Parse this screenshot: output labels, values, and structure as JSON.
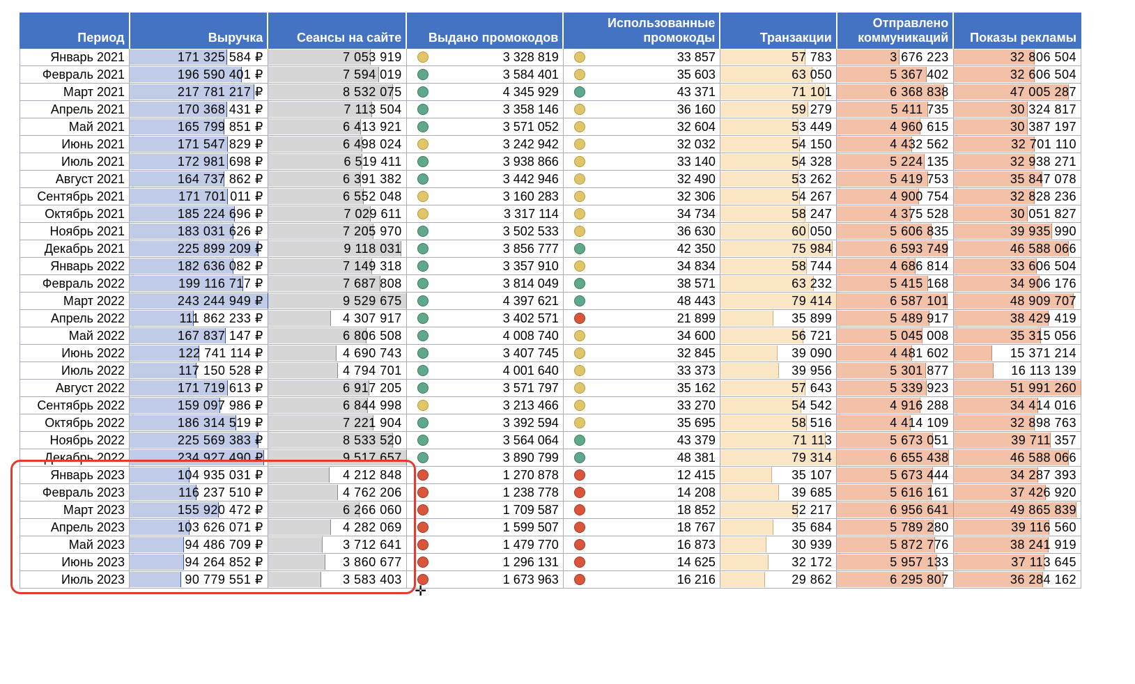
{
  "headers": {
    "period": "Период",
    "revenue": "Выручка",
    "sessions": "Сеансы на сайте",
    "promos_issued": "Выдано промокодов",
    "promos_used": "Использованные промокоды",
    "transactions": "Транзакции",
    "comms_sent": "Отправлено коммуникаций",
    "ad_impressions": "Показы рекламы"
  },
  "max": {
    "revenue": 243244949,
    "sessions": 9529675,
    "transactions": 79414,
    "comms_sent": 6956641,
    "ad_impressions": 51991260
  },
  "indicator_colors": {
    "green": "green",
    "yellow": "yellow",
    "red": "red"
  },
  "highlight": {
    "from_row": 24,
    "to_row": 30
  },
  "rows": [
    {
      "period": "Январь 2021",
      "revenue": "171 325 584 ₽",
      "revenue_n": 171325584,
      "sessions": "7 053 919",
      "sessions_n": 7053919,
      "pi_dot": "yellow",
      "pi": "3 328 819",
      "pu_dot": "yellow",
      "pu": "33 857",
      "tx": "57 783",
      "tx_n": 57783,
      "comm": "3 676 223",
      "comm_n": 3676223,
      "ads": "32 806 504",
      "ads_n": 32806504
    },
    {
      "period": "Февраль 2021",
      "revenue": "196 590 401 ₽",
      "revenue_n": 196590401,
      "sessions": "7 594 019",
      "sessions_n": 7594019,
      "pi_dot": "green",
      "pi": "3 584 401",
      "pu_dot": "yellow",
      "pu": "35 603",
      "tx": "63 050",
      "tx_n": 63050,
      "comm": "5 367 402",
      "comm_n": 5367402,
      "ads": "32 606 504",
      "ads_n": 32606504
    },
    {
      "period": "Март 2021",
      "revenue": "217 781 217 ₽",
      "revenue_n": 217781217,
      "sessions": "8 532 075",
      "sessions_n": 8532075,
      "pi_dot": "green",
      "pi": "4 345 929",
      "pu_dot": "green",
      "pu": "43 371",
      "tx": "71 101",
      "tx_n": 71101,
      "comm": "6 368 838",
      "comm_n": 6368838,
      "ads": "47 005 287",
      "ads_n": 47005287
    },
    {
      "period": "Апрель 2021",
      "revenue": "170 368 431 ₽",
      "revenue_n": 170368431,
      "sessions": "7 113 504",
      "sessions_n": 7113504,
      "pi_dot": "green",
      "pi": "3 358 146",
      "pu_dot": "yellow",
      "pu": "36 160",
      "tx": "59 279",
      "tx_n": 59279,
      "comm": "5 411 735",
      "comm_n": 5411735,
      "ads": "30 324 817",
      "ads_n": 30324817
    },
    {
      "period": "Май 2021",
      "revenue": "165 799 851 ₽",
      "revenue_n": 165799851,
      "sessions": "6 413 921",
      "sessions_n": 6413921,
      "pi_dot": "green",
      "pi": "3 571 052",
      "pu_dot": "yellow",
      "pu": "32 604",
      "tx": "53 449",
      "tx_n": 53449,
      "comm": "4 960 615",
      "comm_n": 4960615,
      "ads": "30 387 197",
      "ads_n": 30387197
    },
    {
      "period": "Июнь 2021",
      "revenue": "171 547 829 ₽",
      "revenue_n": 171547829,
      "sessions": "6 498 024",
      "sessions_n": 6498024,
      "pi_dot": "yellow",
      "pi": "3 242 942",
      "pu_dot": "yellow",
      "pu": "32 032",
      "tx": "54 150",
      "tx_n": 54150,
      "comm": "4 432 562",
      "comm_n": 4432562,
      "ads": "32 701 110",
      "ads_n": 32701110
    },
    {
      "period": "Июль 2021",
      "revenue": "172 981 698 ₽",
      "revenue_n": 172981698,
      "sessions": "6 519 411",
      "sessions_n": 6519411,
      "pi_dot": "green",
      "pi": "3 938 866",
      "pu_dot": "yellow",
      "pu": "33 140",
      "tx": "54 328",
      "tx_n": 54328,
      "comm": "5 224 135",
      "comm_n": 5224135,
      "ads": "32 938 271",
      "ads_n": 32938271
    },
    {
      "period": "Август 2021",
      "revenue": "164 737 862 ₽",
      "revenue_n": 164737862,
      "sessions": "6 391 382",
      "sessions_n": 6391382,
      "pi_dot": "green",
      "pi": "3 442 946",
      "pu_dot": "yellow",
      "pu": "32 490",
      "tx": "53 262",
      "tx_n": 53262,
      "comm": "5 419 753",
      "comm_n": 5419753,
      "ads": "35 847 078",
      "ads_n": 35847078
    },
    {
      "period": "Сентябрь 2021",
      "revenue": "171 701 011 ₽",
      "revenue_n": 171701011,
      "sessions": "6 552 048",
      "sessions_n": 6552048,
      "pi_dot": "yellow",
      "pi": "3 160 283",
      "pu_dot": "yellow",
      "pu": "32 306",
      "tx": "54 267",
      "tx_n": 54267,
      "comm": "4 900 754",
      "comm_n": 4900754,
      "ads": "32 828 236",
      "ads_n": 32828236
    },
    {
      "period": "Октябрь 2021",
      "revenue": "185 224 696 ₽",
      "revenue_n": 185224696,
      "sessions": "7 029 611",
      "sessions_n": 7029611,
      "pi_dot": "yellow",
      "pi": "3 317 114",
      "pu_dot": "yellow",
      "pu": "34 734",
      "tx": "58 247",
      "tx_n": 58247,
      "comm": "4 375 528",
      "comm_n": 4375528,
      "ads": "30 051 827",
      "ads_n": 30051827
    },
    {
      "period": "Ноябрь 2021",
      "revenue": "183 031 626 ₽",
      "revenue_n": 183031626,
      "sessions": "7 205 970",
      "sessions_n": 7205970,
      "pi_dot": "green",
      "pi": "3 502 533",
      "pu_dot": "yellow",
      "pu": "36 630",
      "tx": "60 050",
      "tx_n": 60050,
      "comm": "5 606 835",
      "comm_n": 5606835,
      "ads": "39 935 990",
      "ads_n": 39935990
    },
    {
      "period": "Декабрь 2021",
      "revenue": "225 899 209 ₽",
      "revenue_n": 225899209,
      "sessions": "9 118 031",
      "sessions_n": 9118031,
      "pi_dot": "green",
      "pi": "3 856 777",
      "pu_dot": "green",
      "pu": "42 350",
      "tx": "75 984",
      "tx_n": 75984,
      "comm": "6 593 749",
      "comm_n": 6593749,
      "ads": "46 588 066",
      "ads_n": 46588066
    },
    {
      "period": "Январь 2022",
      "revenue": "182 636 082 ₽",
      "revenue_n": 182636082,
      "sessions": "7 149 318",
      "sessions_n": 7149318,
      "pi_dot": "green",
      "pi": "3 357 910",
      "pu_dot": "yellow",
      "pu": "34 834",
      "tx": "58 744",
      "tx_n": 58744,
      "comm": "4 686 814",
      "comm_n": 4686814,
      "ads": "33 606 504",
      "ads_n": 33606504
    },
    {
      "period": "Февраль 2022",
      "revenue": "199 116 717 ₽",
      "revenue_n": 199116717,
      "sessions": "7 687 808",
      "sessions_n": 7687808,
      "pi_dot": "green",
      "pi": "3 814 049",
      "pu_dot": "green",
      "pu": "38 571",
      "tx": "63 232",
      "tx_n": 63232,
      "comm": "5 415 168",
      "comm_n": 5415168,
      "ads": "34 906 176",
      "ads_n": 34906176
    },
    {
      "period": "Март 2022",
      "revenue": "243 244 949 ₽",
      "revenue_n": 243244949,
      "sessions": "9 529 675",
      "sessions_n": 9529675,
      "pi_dot": "green",
      "pi": "4 397 621",
      "pu_dot": "green",
      "pu": "48 443",
      "tx": "79 414",
      "tx_n": 79414,
      "comm": "6 587 101",
      "comm_n": 6587101,
      "ads": "48 909 707",
      "ads_n": 48909707
    },
    {
      "period": "Апрель 2022",
      "revenue": "111 862 233 ₽",
      "revenue_n": 111862233,
      "sessions": "4 307 917",
      "sessions_n": 4307917,
      "pi_dot": "green",
      "pi": "3 402 571",
      "pu_dot": "red",
      "pu": "21 899",
      "tx": "35 899",
      "tx_n": 35899,
      "comm": "5 489 917",
      "comm_n": 5489917,
      "ads": "38 429 419",
      "ads_n": 38429419
    },
    {
      "period": "Май 2022",
      "revenue": "167 837 147 ₽",
      "revenue_n": 167837147,
      "sessions": "6 806 508",
      "sessions_n": 6806508,
      "pi_dot": "green",
      "pi": "4 008 740",
      "pu_dot": "yellow",
      "pu": "34 600",
      "tx": "56 721",
      "tx_n": 56721,
      "comm": "5 045 008",
      "comm_n": 5045008,
      "ads": "35 315 056",
      "ads_n": 35315056
    },
    {
      "period": "Июнь 2022",
      "revenue": "122 741 114 ₽",
      "revenue_n": 122741114,
      "sessions": "4 690 743",
      "sessions_n": 4690743,
      "pi_dot": "green",
      "pi": "3 407 745",
      "pu_dot": "yellow",
      "pu": "32 845",
      "tx": "39 090",
      "tx_n": 39090,
      "comm": "4 481 602",
      "comm_n": 4481602,
      "ads": "15 371 214",
      "ads_n": 15371214
    },
    {
      "period": "Июль 2022",
      "revenue": "117 150 528 ₽",
      "revenue_n": 117150528,
      "sessions": "4 794 701",
      "sessions_n": 4794701,
      "pi_dot": "green",
      "pi": "4 001 640",
      "pu_dot": "yellow",
      "pu": "33 373",
      "tx": "39 956",
      "tx_n": 39956,
      "comm": "5 301 877",
      "comm_n": 5301877,
      "ads": "16 113 139",
      "ads_n": 16113139
    },
    {
      "period": "Август 2022",
      "revenue": "171 719 613 ₽",
      "revenue_n": 171719613,
      "sessions": "6 917 205",
      "sessions_n": 6917205,
      "pi_dot": "green",
      "pi": "3 571 797",
      "pu_dot": "yellow",
      "pu": "35 162",
      "tx": "57 643",
      "tx_n": 57643,
      "comm": "5 339 923",
      "comm_n": 5339923,
      "ads": "51 991 260",
      "ads_n": 51991260
    },
    {
      "period": "Сентябрь 2022",
      "revenue": "159 097 986 ₽",
      "revenue_n": 159097986,
      "sessions": "6 844 998",
      "sessions_n": 6844998,
      "pi_dot": "yellow",
      "pi": "3 213 466",
      "pu_dot": "yellow",
      "pu": "33 270",
      "tx": "54 542",
      "tx_n": 54542,
      "comm": "4 916 288",
      "comm_n": 4916288,
      "ads": "34 414 016",
      "ads_n": 34414016
    },
    {
      "period": "Октябрь 2022",
      "revenue": "186 314 519 ₽",
      "revenue_n": 186314519,
      "sessions": "7 221 904",
      "sessions_n": 7221904,
      "pi_dot": "green",
      "pi": "3 392 594",
      "pu_dot": "yellow",
      "pu": "35 695",
      "tx": "58 516",
      "tx_n": 58516,
      "comm": "4 414 109",
      "comm_n": 4414109,
      "ads": "32 898 763",
      "ads_n": 32898763
    },
    {
      "period": "Ноябрь 2022",
      "revenue": "225 569 383 ₽",
      "revenue_n": 225569383,
      "sessions": "8 533 520",
      "sessions_n": 8533520,
      "pi_dot": "green",
      "pi": "3 564 064",
      "pu_dot": "green",
      "pu": "43 379",
      "tx": "71 113",
      "tx_n": 71113,
      "comm": "5 673 051",
      "comm_n": 5673051,
      "ads": "39 711 357",
      "ads_n": 39711357
    },
    {
      "period": "Декабрь 2022",
      "revenue": "234 927 490 ₽",
      "revenue_n": 234927490,
      "sessions": "9 517 657",
      "sessions_n": 9517657,
      "pi_dot": "green",
      "pi": "3 890 799",
      "pu_dot": "green",
      "pu": "48 381",
      "tx": "79 314",
      "tx_n": 79314,
      "comm": "6 655 438",
      "comm_n": 6655438,
      "ads": "46 588 066",
      "ads_n": 46588066
    },
    {
      "period": "Январь 2023",
      "revenue": "104 935 031 ₽",
      "revenue_n": 104935031,
      "sessions": "4 212 848",
      "sessions_n": 4212848,
      "pi_dot": "red",
      "pi": "1 270 878",
      "pu_dot": "red",
      "pu": "12 415",
      "tx": "35 107",
      "tx_n": 35107,
      "comm": "5 673 444",
      "comm_n": 5673444,
      "ads": "34 287 393",
      "ads_n": 34287393
    },
    {
      "period": "Февраль 2023",
      "revenue": "116 237 510 ₽",
      "revenue_n": 116237510,
      "sessions": "4 762 206",
      "sessions_n": 4762206,
      "pi_dot": "red",
      "pi": "1 238 778",
      "pu_dot": "red",
      "pu": "14 208",
      "tx": "39 685",
      "tx_n": 39685,
      "comm": "5 616 161",
      "comm_n": 5616161,
      "ads": "37 426 920",
      "ads_n": 37426920
    },
    {
      "period": "Март 2023",
      "revenue": "155 920 472 ₽",
      "revenue_n": 155920472,
      "sessions": "6 266 060",
      "sessions_n": 6266060,
      "pi_dot": "red",
      "pi": "1 709 587",
      "pu_dot": "red",
      "pu": "18 852",
      "tx": "52 217",
      "tx_n": 52217,
      "comm": "6 956 641",
      "comm_n": 6956641,
      "ads": "49 865 839",
      "ads_n": 49865839
    },
    {
      "period": "Апрель 2023",
      "revenue": "103 626 071 ₽",
      "revenue_n": 103626071,
      "sessions": "4 282 069",
      "sessions_n": 4282069,
      "pi_dot": "red",
      "pi": "1 599 507",
      "pu_dot": "red",
      "pu": "18 767",
      "tx": "35 684",
      "tx_n": 35684,
      "comm": "5 789 280",
      "comm_n": 5789280,
      "ads": "39 116 560",
      "ads_n": 39116560
    },
    {
      "period": "Май 2023",
      "revenue": "94 486 709 ₽",
      "revenue_n": 94486709,
      "sessions": "3 712 641",
      "sessions_n": 3712641,
      "pi_dot": "red",
      "pi": "1 479 770",
      "pu_dot": "red",
      "pu": "16 873",
      "tx": "30 939",
      "tx_n": 30939,
      "comm": "5 872 776",
      "comm_n": 5872776,
      "ads": "38 241 919",
      "ads_n": 38241919
    },
    {
      "period": "Июнь 2023",
      "revenue": "94 264 852 ₽",
      "revenue_n": 94264852,
      "sessions": "3 860 677",
      "sessions_n": 3860677,
      "pi_dot": "red",
      "pi": "1 296 131",
      "pu_dot": "red",
      "pu": "14 625",
      "tx": "32 172",
      "tx_n": 32172,
      "comm": "5 957 133",
      "comm_n": 5957133,
      "ads": "37 113 645",
      "ads_n": 37113645
    },
    {
      "period": "Июль 2023",
      "revenue": "90 779 551 ₽",
      "revenue_n": 90779551,
      "sessions": "3 583 403",
      "sessions_n": 3583403,
      "pi_dot": "red",
      "pi": "1 673 963",
      "pu_dot": "red",
      "pu": "16 216",
      "tx": "29 862",
      "tx_n": 29862,
      "comm": "6 295 807",
      "comm_n": 6295807,
      "ads": "36 284 162",
      "ads_n": 36284162
    }
  ]
}
